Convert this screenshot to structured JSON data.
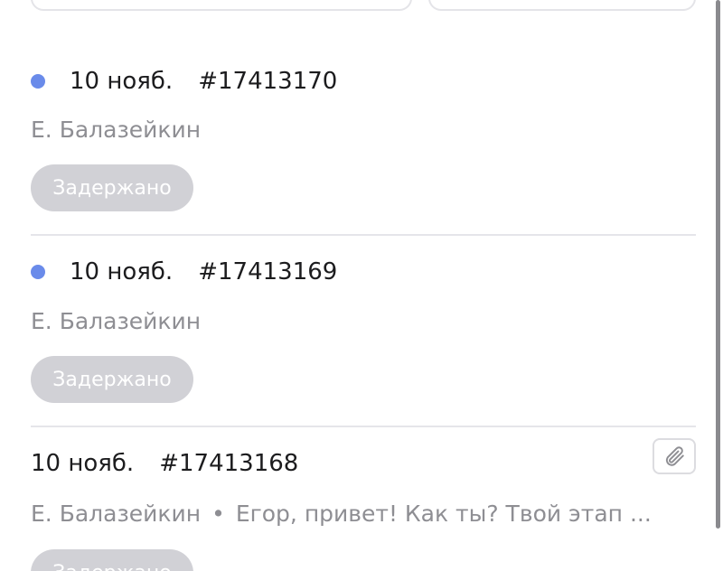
{
  "colors": {
    "unread_dot": "#6a8bea",
    "badge_bg": "#d1d1d6",
    "muted_text": "#8e8e93"
  },
  "items": [
    {
      "date": "10 нояб.",
      "number": "#17413170",
      "author": "Е. Балазейкин",
      "status": "Задержано",
      "unread": true
    },
    {
      "date": "10 нояб.",
      "number": "#17413169",
      "author": "Е. Балазейкин",
      "status": "Задержано",
      "unread": true
    },
    {
      "date": "10 нояб.",
      "number": "#17413168",
      "author": "Е. Балазейкин",
      "separator": "•",
      "preview": "Егор, привет! Как ты? Твой этап ...",
      "status": "Задержано",
      "unread": false,
      "attachment_icon": "paperclip-icon"
    }
  ]
}
